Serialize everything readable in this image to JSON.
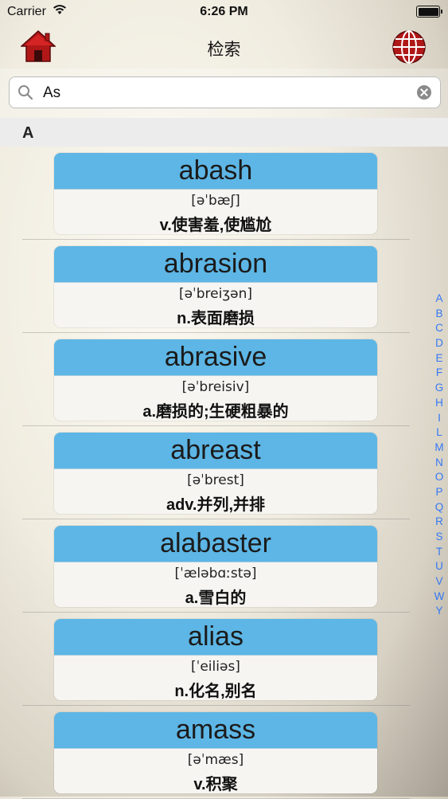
{
  "status": {
    "carrier": "Carrier",
    "time": "6:26 PM"
  },
  "nav": {
    "title": "检索",
    "home_icon": "home-icon",
    "globe_icon": "globe-icon"
  },
  "search": {
    "value": "As"
  },
  "section": {
    "letter": "A"
  },
  "entries": [
    {
      "word": "abash",
      "phonetic": "[əˈbæʃ]",
      "meaning": "v.使害羞,使尴尬"
    },
    {
      "word": "abrasion",
      "phonetic": "[əˈbreiʒən]",
      "meaning": "n.表面磨损"
    },
    {
      "word": "abrasive",
      "phonetic": "[əˈbreisiv]",
      "meaning": "a.磨损的;生硬粗暴的"
    },
    {
      "word": "abreast",
      "phonetic": "[əˈbrest]",
      "meaning": "adv.并列,并排"
    },
    {
      "word": "alabaster",
      "phonetic": "[ˈæləbɑːstə]",
      "meaning": "a.雪白的"
    },
    {
      "word": "alias",
      "phonetic": "[ˈeiliəs]",
      "meaning": "n.化名,别名"
    },
    {
      "word": "amass",
      "phonetic": "[əˈmæs]",
      "meaning": "v.积聚"
    }
  ],
  "index_letters": [
    "A",
    "B",
    "C",
    "D",
    "E",
    "F",
    "G",
    "H",
    "I",
    "L",
    "M",
    "N",
    "O",
    "P",
    "Q",
    "R",
    "S",
    "T",
    "U",
    "V",
    "W",
    "Y"
  ],
  "colors": {
    "card_header": "#5db6e5",
    "index_link": "#3478f6",
    "home_icon": "#b01818"
  }
}
